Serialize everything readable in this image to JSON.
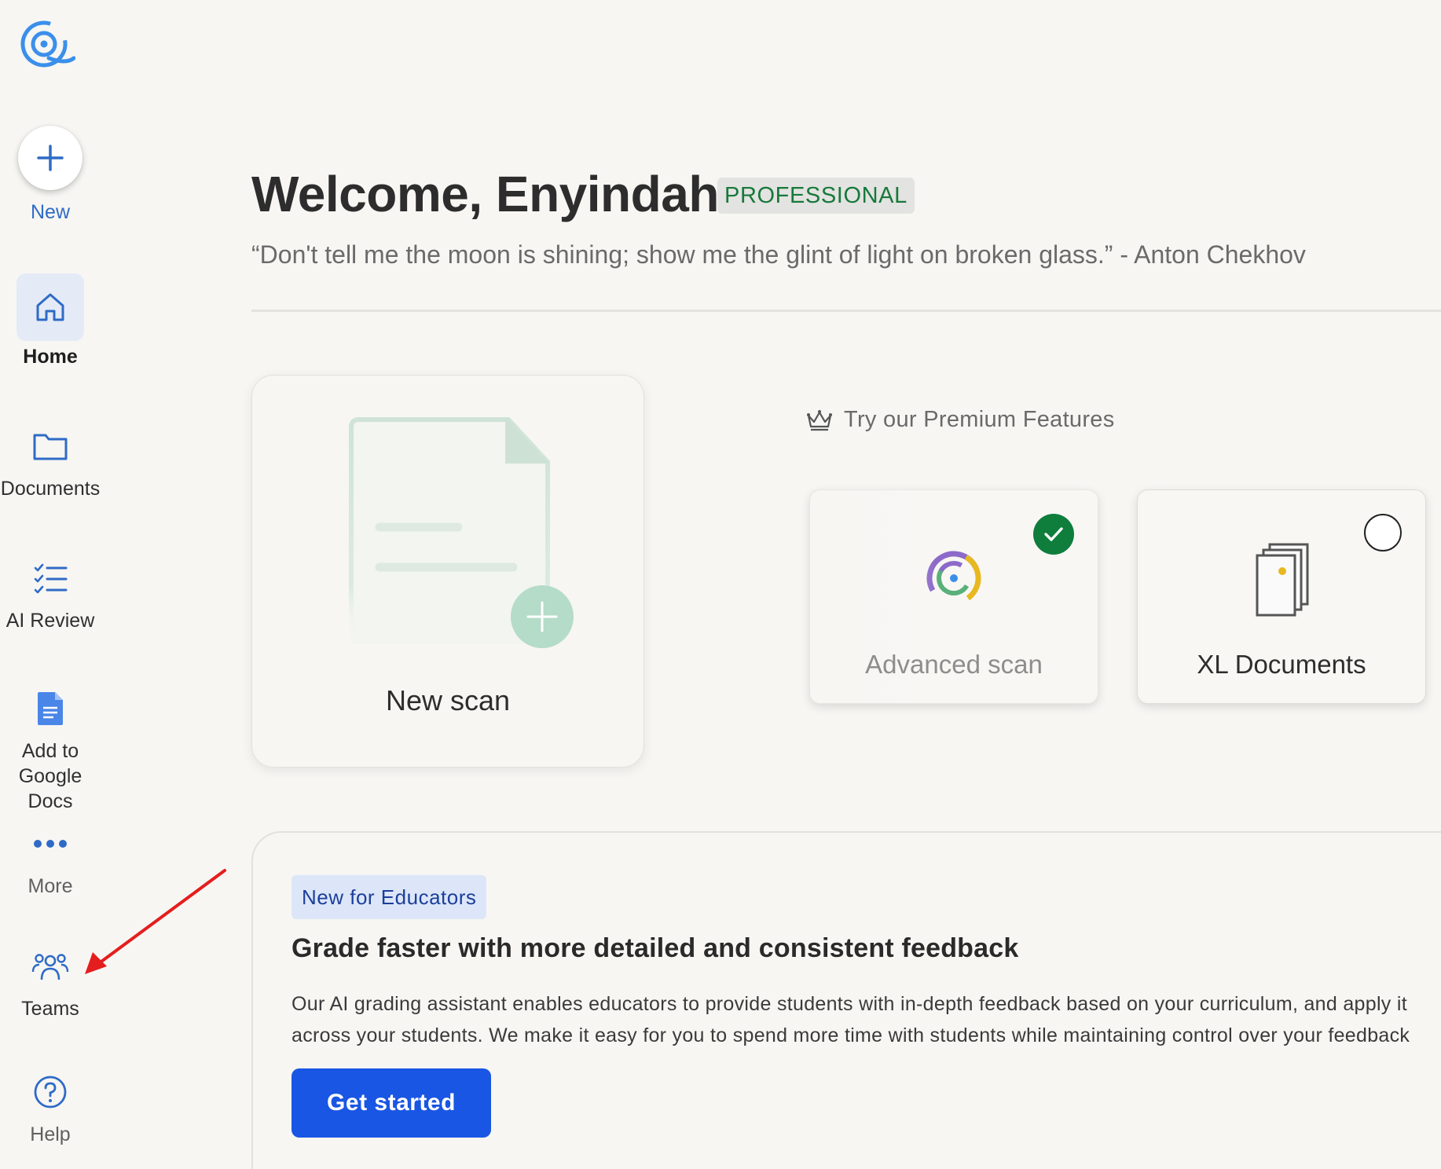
{
  "sidebar": {
    "items": [
      {
        "label": "New",
        "icon": "plus-icon"
      },
      {
        "label": "Home",
        "icon": "home-icon"
      },
      {
        "label": "Documents",
        "icon": "folder-icon"
      },
      {
        "label": "AI Review",
        "icon": "checklist-icon"
      },
      {
        "label": "Add to Google Docs",
        "line1": "Add to",
        "line2": "Google",
        "line3": "Docs",
        "icon": "google-docs-icon"
      },
      {
        "label": "More",
        "icon": "more-dots-icon"
      },
      {
        "label": "Teams",
        "icon": "teams-icon"
      },
      {
        "label": "Help",
        "icon": "help-icon"
      }
    ]
  },
  "header": {
    "welcome": "Welcome, Enyindah",
    "plan_badge": "PROFESSIONAL",
    "quote": "“Don't tell me the moon is shining; show me the glint of light on broken glass.” - Anton Chekhov"
  },
  "scan_card": {
    "label": "New scan"
  },
  "premium": {
    "heading": "Try our Premium Features",
    "features": [
      {
        "label": "Advanced scan",
        "selected": true
      },
      {
        "label": "XL Documents",
        "selected": false
      }
    ]
  },
  "educators": {
    "badge": "New for Educators",
    "title": "Grade faster with more detailed and consistent feedback",
    "line1": "Our AI grading assistant enables educators to provide students with in-depth feedback based on your curriculum, and apply it",
    "line2": "across your students. We make it easy for you to spend more time with students while maintaining control over your feedback",
    "cta": "Get started"
  },
  "colors": {
    "accent_blue": "#1a56e4",
    "badge_green": "#17793b",
    "check_green": "#0f7d3c",
    "annotation_red": "#e41e1e"
  }
}
